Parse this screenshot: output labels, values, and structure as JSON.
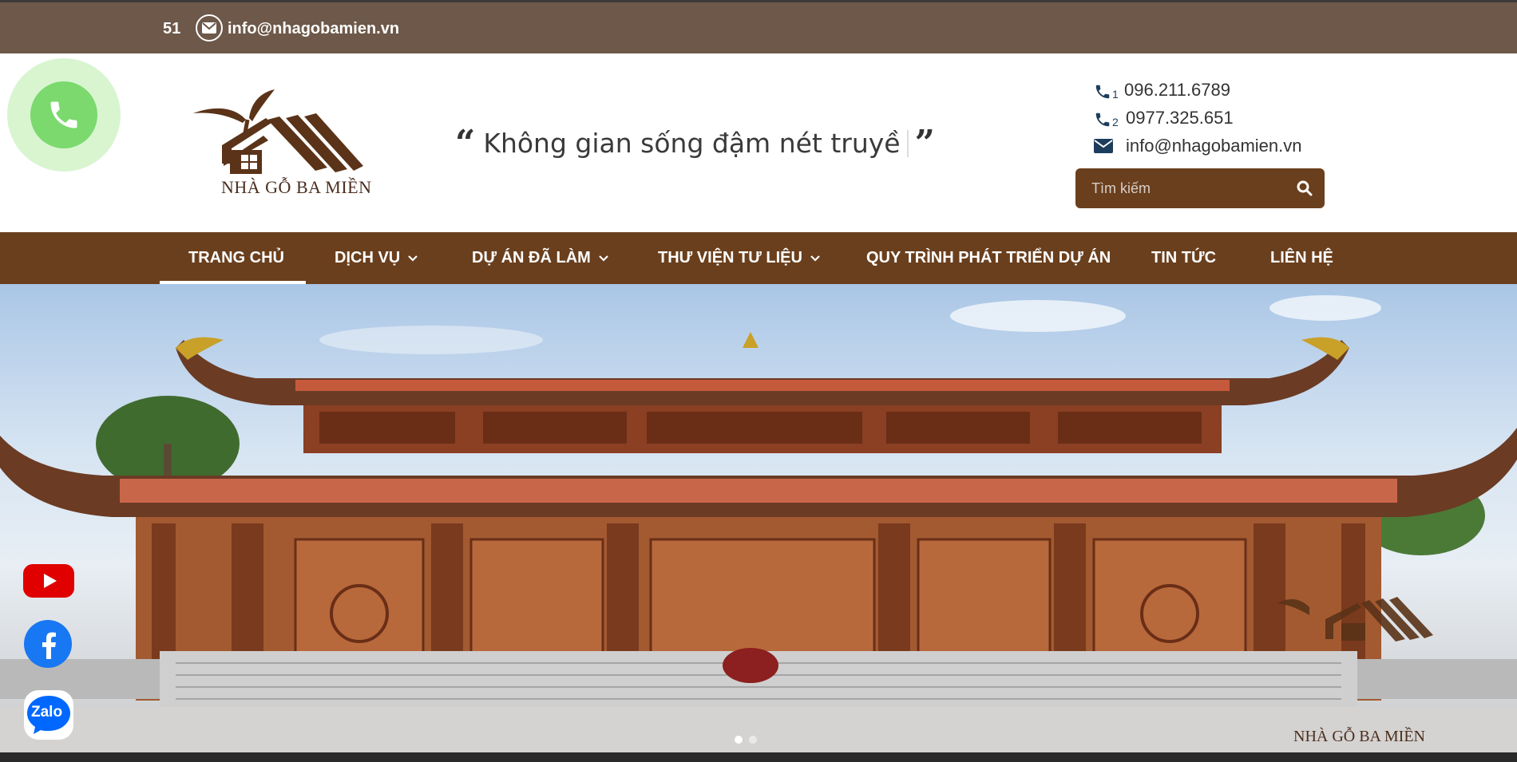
{
  "topbar": {
    "phone_fragment": "51",
    "email": "info@nhagobamien.vn"
  },
  "brand": {
    "name": "NHÀ GỖ BA MIỀN",
    "colors": {
      "primary": "#6a3f1d",
      "topbar": "#6d5849",
      "call": "#7bd96e"
    }
  },
  "slogan": {
    "text": "Không gian sống đậm nét truyề"
  },
  "contact": {
    "phone1_index": "1",
    "phone1": "096.211.6789",
    "phone2_index": "2",
    "phone2": "0977.325.651",
    "email": "info@nhagobamien.vn"
  },
  "search": {
    "placeholder": "Tìm kiếm",
    "icon": "search-icon"
  },
  "nav": {
    "items": [
      {
        "label": "TRANG CHỦ",
        "active": true,
        "dropdown": false
      },
      {
        "label": "DỊCH VỤ",
        "active": false,
        "dropdown": true
      },
      {
        "label": "DỰ ÁN ĐÃ LÀM",
        "active": false,
        "dropdown": true
      },
      {
        "label": "THƯ VIỆN TƯ LIỆU",
        "active": false,
        "dropdown": true
      },
      {
        "label": "QUY TRÌNH PHÁT TRIỂN DỰ ÁN",
        "active": false,
        "dropdown": false
      },
      {
        "label": "TIN TỨC",
        "active": false,
        "dropdown": false
      },
      {
        "label": "LIÊN HỆ",
        "active": false,
        "dropdown": false
      }
    ]
  },
  "hero": {
    "watermark": "NHÀ GỖ BA MIỀN",
    "slide_count": 2,
    "active_slide": 1
  },
  "social": {
    "youtube": "youtube-icon",
    "facebook": "facebook-icon",
    "zalo_label": "Zalo"
  }
}
